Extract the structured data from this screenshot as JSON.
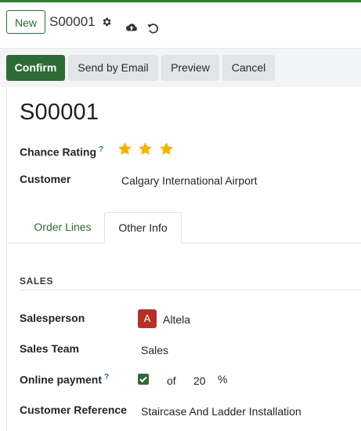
{
  "breadcrumb": {
    "new_label": "New",
    "record_ref": "S00001",
    "icons": [
      "gear-icon",
      "cloud-upload-icon",
      "undo-icon"
    ]
  },
  "actions": {
    "confirm": "Confirm",
    "send_email": "Send by Email",
    "preview": "Preview",
    "cancel": "Cancel"
  },
  "form": {
    "title": "S00001",
    "chance_rating_label": "Chance Rating",
    "chance_rating_help": "?",
    "chance_rating_value": 3,
    "customer_label": "Customer",
    "customer_value": "Calgary International Airport"
  },
  "tabs": {
    "order_lines": "Order Lines",
    "other_info": "Other Info",
    "active": "Other Info"
  },
  "sales": {
    "section_title": "SALES",
    "salesperson_label": "Salesperson",
    "salesperson_avatar": "A",
    "salesperson_value": "Altela",
    "sales_team_label": "Sales Team",
    "sales_team_value": "Sales",
    "online_payment_label": "Online payment",
    "online_payment_help": "?",
    "online_payment_checked": true,
    "online_payment_of": "of",
    "online_payment_percent": "20",
    "online_payment_unit": "%",
    "customer_reference_label": "Customer Reference",
    "customer_reference_value": "Staircase And Ladder Installation"
  },
  "colors": {
    "accent": "#2e6b35",
    "star": "#f3b400",
    "avatar": "#b4302a"
  }
}
